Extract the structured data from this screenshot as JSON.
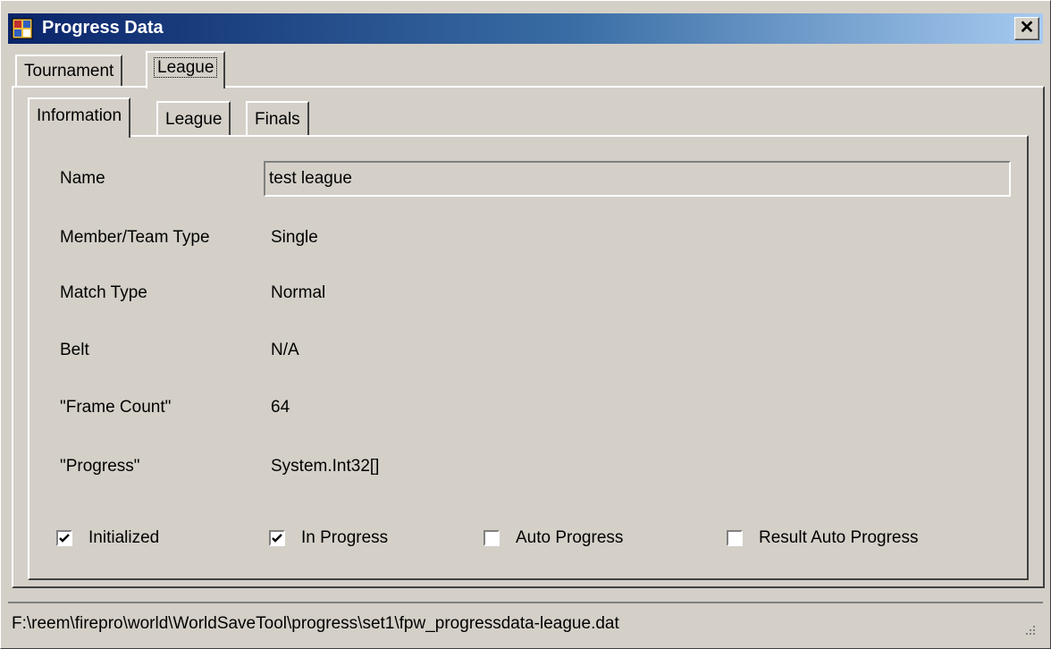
{
  "window": {
    "title": "Progress Data",
    "close_glyph": "✕"
  },
  "outer_tabs": [
    {
      "label": "Tournament",
      "selected": false
    },
    {
      "label": "League",
      "selected": true
    }
  ],
  "inner_tabs": [
    {
      "label": "Information",
      "selected": true
    },
    {
      "label": "League",
      "selected": false
    },
    {
      "label": "Finals",
      "selected": false
    }
  ],
  "fields": {
    "name_label": "Name",
    "name_value": "test league",
    "member_type_label": "Member/Team Type",
    "member_type_value": "Single",
    "match_type_label": "Match Type",
    "match_type_value": "Normal",
    "belt_label": "Belt",
    "belt_value": "N/A",
    "frame_count_label": "\"Frame Count\"",
    "frame_count_value": "64",
    "progress_label": "\"Progress\"",
    "progress_value": "System.Int32[]"
  },
  "checkboxes": [
    {
      "label": "Initialized",
      "checked": true
    },
    {
      "label": "In Progress",
      "checked": true
    },
    {
      "label": "Auto Progress",
      "checked": false
    },
    {
      "label": "Result Auto Progress",
      "checked": false
    }
  ],
  "status": {
    "path": "F:\\reem\\firepro\\world\\WorldSaveTool\\progress\\set1\\fpw_progressdata-league.dat"
  },
  "icons": {
    "app": "app-window-icon",
    "close": "close-icon",
    "grip": "resize-grip-icon"
  },
  "colors": {
    "face": "#d4d0c8",
    "title_start": "#0a246a",
    "title_end": "#a6caf0"
  }
}
